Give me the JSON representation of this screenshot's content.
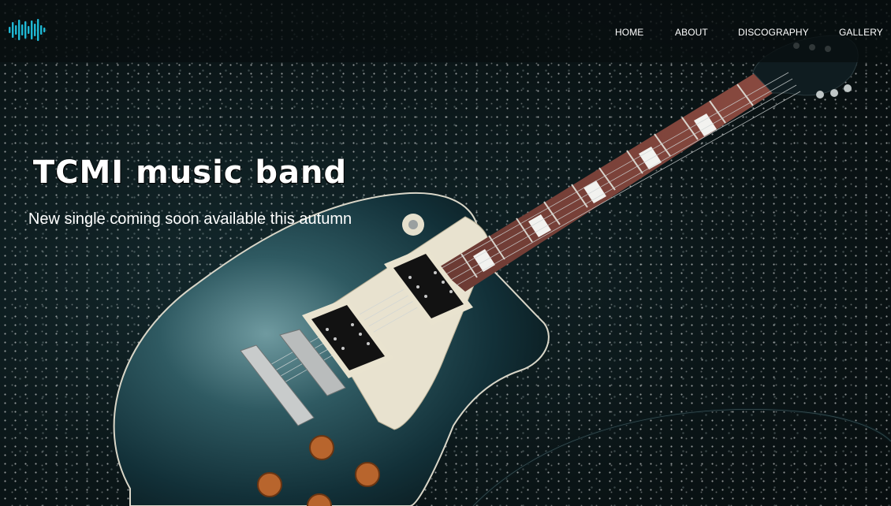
{
  "brand": {
    "logo_icon": "soundwave-icon",
    "accent": "#1fb8d4"
  },
  "nav": {
    "items": [
      {
        "label": "HOME"
      },
      {
        "label": "ABOUT"
      },
      {
        "label": "DISCOGRAPHY"
      },
      {
        "label": "GALLERY"
      }
    ]
  },
  "hero": {
    "title": "TCMI music band",
    "subtitle": "New single coming soon available this autumn"
  }
}
